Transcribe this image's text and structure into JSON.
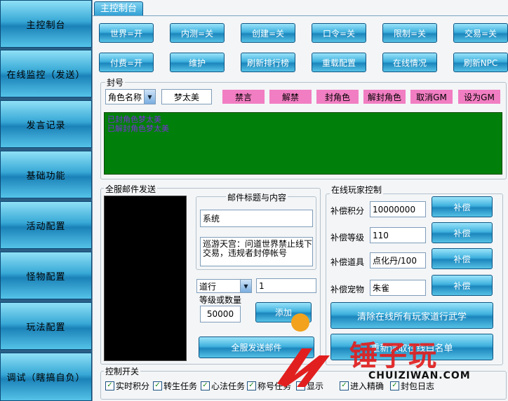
{
  "sidebar": {
    "items": [
      {
        "label": "主控制台"
      },
      {
        "label": "在线监控（发送）"
      },
      {
        "label": "发言记录"
      },
      {
        "label": "基础功能"
      },
      {
        "label": "活动配置"
      },
      {
        "label": "怪物配置"
      },
      {
        "label": "玩法配置"
      },
      {
        "label": "调试（瞎搞自负）"
      }
    ]
  },
  "tab": {
    "label": "主控制台"
  },
  "toolbar": {
    "row1": [
      "世界=开",
      "内测=关",
      "创建=关",
      "口令=关",
      "限制=关",
      "交易=关"
    ],
    "row2": [
      "付费=开",
      "维护",
      "刷新排行榜",
      "重载配置",
      "在线情况",
      "刷新NPC"
    ]
  },
  "ban": {
    "title": "封号",
    "select_value": "角色名称",
    "name_value": "梦太美",
    "actions": [
      "禁言",
      "解禁",
      "封角色",
      "解封角色",
      "取消GM",
      "设为GM"
    ],
    "log_lines": [
      "已封角色梦太美",
      "已解封角色梦太美"
    ]
  },
  "mail": {
    "title": "全服邮件发送",
    "subject_group": "邮件标题与内容",
    "subject_value": "系统",
    "content_value": "巡游天宫：问道世界禁止线下交易，违规者封停帐号",
    "item_type": "道行",
    "item_value": "1",
    "qty_label": "等级或数量",
    "qty_value": "50000",
    "add_label": "添加",
    "send_label": "全服发送邮件"
  },
  "player_ctrl": {
    "title": "在线玩家控制",
    "rows": [
      {
        "label": "补偿积分",
        "value": "10000000",
        "button": "补偿"
      },
      {
        "label": "补偿等级",
        "value": "110",
        "button": "补偿"
      },
      {
        "label": "补偿道具",
        "value": "点化丹/100",
        "button": "补偿"
      },
      {
        "label": "补偿宠物",
        "value": "朱雀",
        "button": "补偿"
      }
    ],
    "clear_label": "清除在线所有玩家道行武学",
    "bottom_label": "重新读取在线白名单"
  },
  "switches": {
    "title": "控制开关",
    "items": [
      "实时积分",
      "转生任务",
      "心法任务",
      "称号任务",
      "显示",
      "进入精确",
      "封包日志"
    ]
  },
  "watermark": {
    "text": "锤子玩",
    "url": "CHUIZIWAN.COM"
  },
  "colors": {
    "log_bg": "#00800a",
    "log_text": "#7b2fd6",
    "pink": "#f17ec2",
    "sidebar": "#2b5f86"
  }
}
